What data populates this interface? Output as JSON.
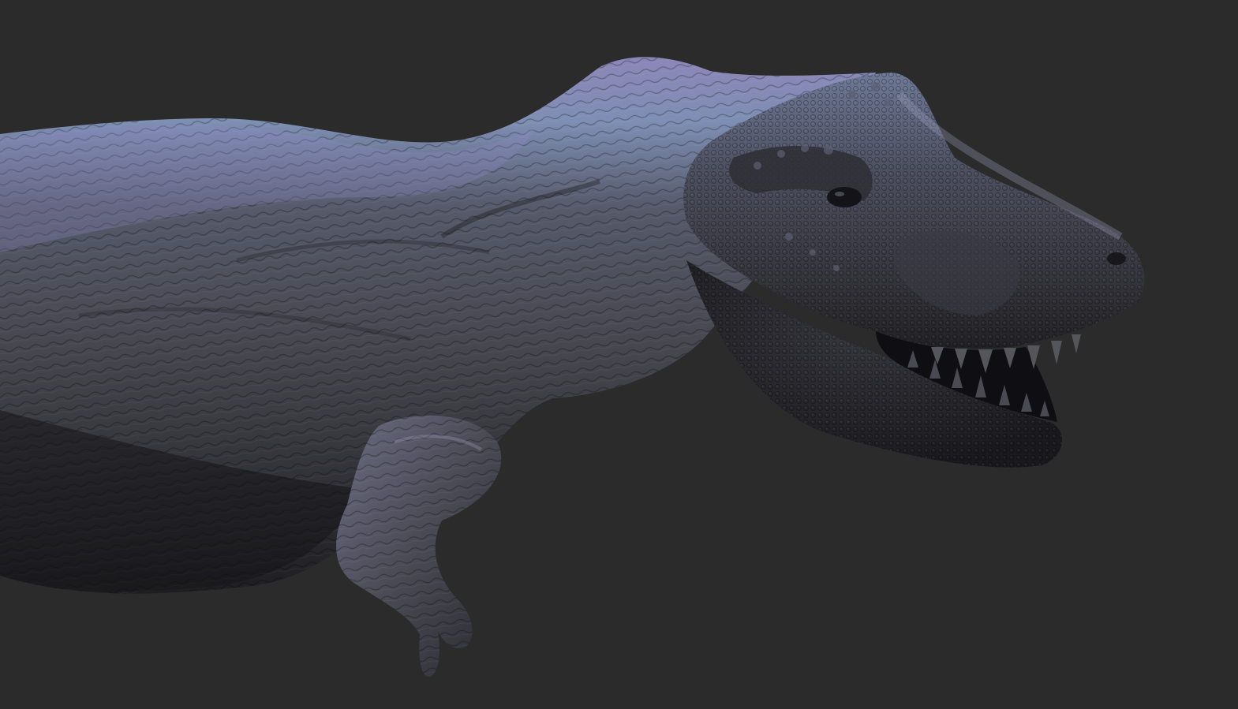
{
  "scene": {
    "subject": "tyrannosaurus-sculpt",
    "colors": {
      "background": "#2b2b2b",
      "skin_base": "#4a4a52",
      "skin_dark": "#1f1f24",
      "skin_highlight": "#8a86a8",
      "iridescent_blue": "#6f8fb0",
      "iridescent_violet": "#8d7fb6",
      "mouth_interior": "#101014",
      "teeth": "#5a5a60"
    }
  }
}
